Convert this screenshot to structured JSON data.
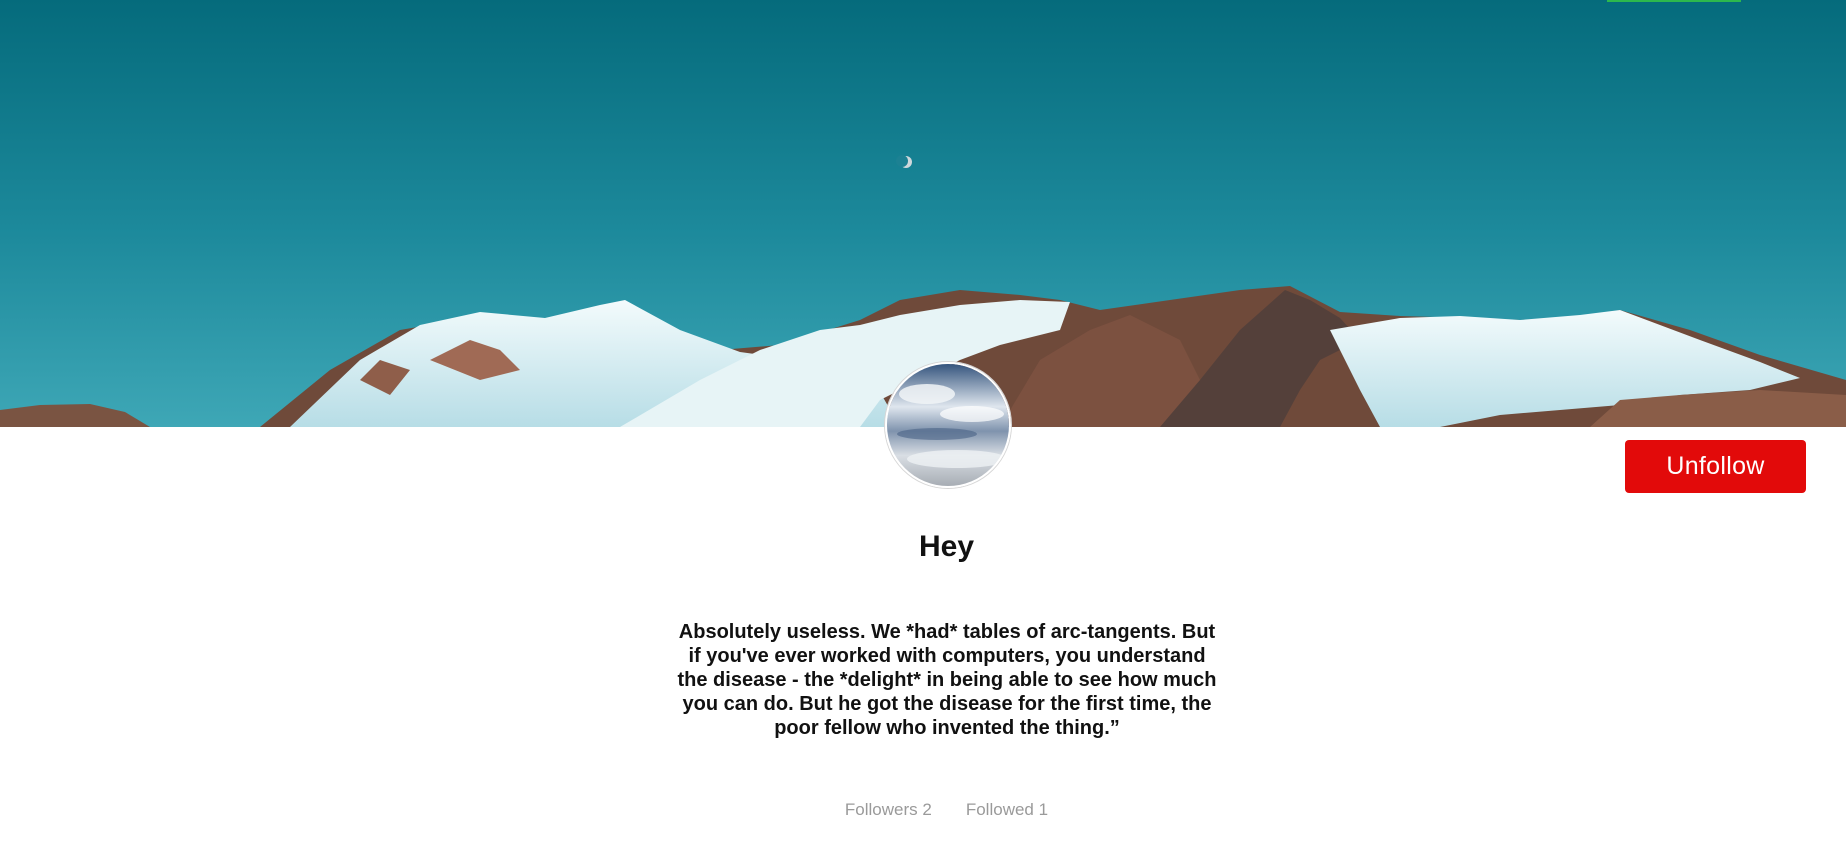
{
  "profile": {
    "username": "Hey",
    "bio": "Absolutely useless. We *had* tables of arc-tangents. But if you've ever worked with computers, you understand the disease - the *delight* in being able to see how much you can do. But he got the disease for the first time, the poor fellow who invented the thing.”",
    "unfollow_label": "Unfollow"
  },
  "stats": {
    "followers_label": "Followers",
    "followers_count": "2",
    "followed_label": "Followed",
    "followed_count": "1"
  },
  "colors": {
    "unfollow_button": "#e20a0a",
    "sky_top": "#056d7e",
    "sky_bottom": "#3aa4b4",
    "accent_bar": "#2db84d"
  },
  "images": {
    "cover": "snowy-mountains-cover-image",
    "avatar": "cloudy-sky-avatar-image"
  }
}
